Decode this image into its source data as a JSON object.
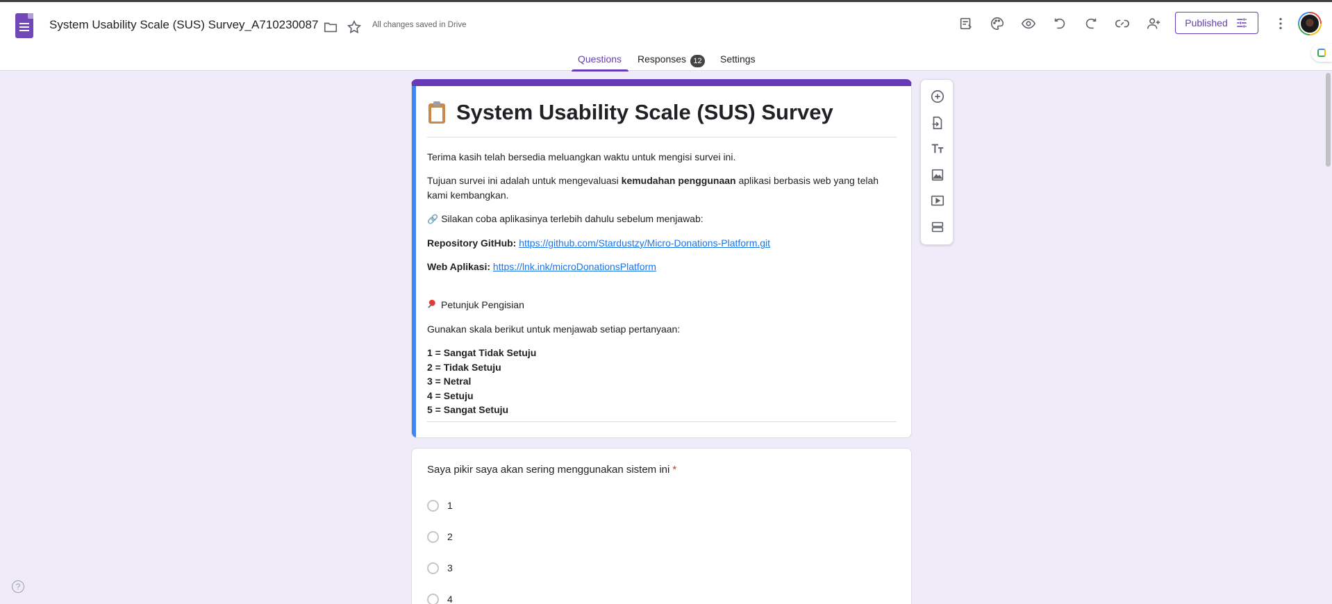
{
  "header": {
    "doc_title": "System Usability Scale (SUS) Survey_A710230087",
    "save_status": "All changes saved in Drive",
    "published_label": "Published"
  },
  "tabs": [
    {
      "label": "Questions",
      "active": true
    },
    {
      "label": "Responses",
      "badge": "12"
    },
    {
      "label": "Settings"
    }
  ],
  "form": {
    "title": "System Usability Scale (SUS) Survey",
    "desc1": "Terima kasih telah bersedia meluangkan waktu untuk mengisi survei ini.",
    "desc2_before": "Tujuan survei ini adalah untuk mengevaluasi ",
    "desc2_bold": "kemudahan penggunaan",
    "desc2_after": " aplikasi berbasis web yang telah kami kembangkan.",
    "try_app": "Silakan coba aplikasinya terlebih dahulu sebelum menjawab:",
    "repo_label": "Repository GitHub:",
    "repo_url": "https://github.com/Stardustzy/Micro-Donations-Platform.git",
    "web_label": "Web Aplikasi:",
    "web_url": "https://lnk.ink/microDonationsPlatform",
    "instructions_heading": "Petunjuk Pengisian",
    "instructions_text": "Gunakan skala berikut untuk menjawab setiap pertanyaan:",
    "scale": [
      "1 = Sangat Tidak Setuju",
      "2 = Tidak Setuju",
      "3 = Netral",
      "4 = Setuju",
      "5 = Sangat Setuju"
    ]
  },
  "question1": {
    "text": "Saya pikir saya akan sering menggunakan sistem ini",
    "required_mark": "*",
    "options": [
      "1",
      "2",
      "3",
      "4"
    ]
  },
  "colors": {
    "accent": "#673ab7",
    "background": "#f0ebf8",
    "link": "#1a73e8",
    "required": "#d93025"
  },
  "icons": {
    "header": [
      "folder-icon",
      "star-icon",
      "customize-theme-icon",
      "palette-icon",
      "preview-icon",
      "undo-icon",
      "redo-icon",
      "link-icon",
      "add-collaborator-icon",
      "more-vert-icon"
    ],
    "toolbar": [
      "add-question-icon",
      "import-questions-icon",
      "add-title-icon",
      "add-image-icon",
      "add-video-icon",
      "add-section-icon"
    ]
  }
}
